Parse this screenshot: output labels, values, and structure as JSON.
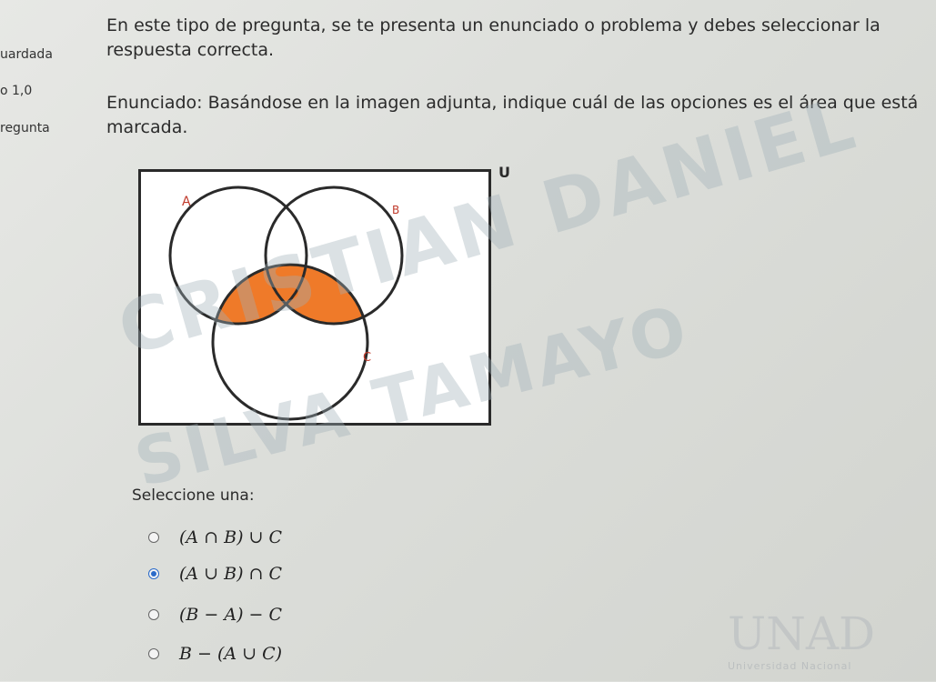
{
  "sidebar": {
    "items": [
      {
        "label": "uardada"
      },
      {
        "label": "o 1,0"
      },
      {
        "label": "regunta"
      }
    ]
  },
  "question": {
    "intro": "En este tipo de pregunta, se te presenta un enunciado o problema y debes seleccionar la respuesta correcta.",
    "statement": "Enunciado: Basándose en la imagen adjunta, indique cuál de las opciones es el área que está marcada."
  },
  "figure": {
    "universe_label": "U",
    "set_a_label": "A",
    "set_b_label": "B",
    "set_c_label": "C",
    "shade_color": "#ef7a29"
  },
  "watermark": {
    "line1": "CRISTIAN DANIEL",
    "line2": "SILVA TAMAYO"
  },
  "answers": {
    "prompt": "Seleccione una:",
    "options": [
      {
        "label": "(A ∩ B) ∪ C",
        "selected": false
      },
      {
        "label": "(A ∪ B) ∩ C",
        "selected": true
      },
      {
        "label": "(B − A) − C",
        "selected": false
      },
      {
        "label": "B − (A ∪ C)",
        "selected": false
      }
    ]
  },
  "logo": {
    "text": "UNAD",
    "subtitle": "Universidad Nacional"
  }
}
